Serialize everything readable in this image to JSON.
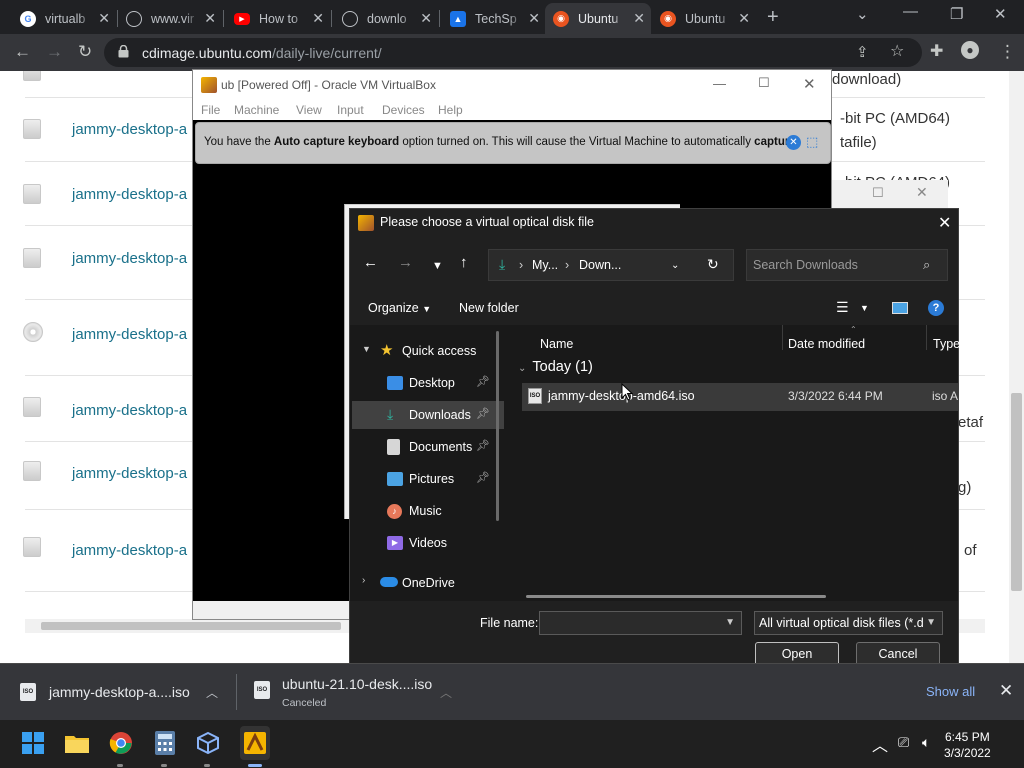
{
  "browser": {
    "tabs": [
      {
        "label": "virtualb",
        "icon": "google-icon",
        "active": false
      },
      {
        "label": "www.vir",
        "icon": "globe-icon",
        "active": false
      },
      {
        "label": "How to",
        "icon": "youtube-icon",
        "active": false
      },
      {
        "label": "downlo",
        "icon": "globe-icon",
        "active": false
      },
      {
        "label": "TechSp",
        "icon": "techspot-icon",
        "active": false
      },
      {
        "label": "Ubuntu",
        "icon": "ubuntu-icon",
        "active": true
      },
      {
        "label": "Ubuntu",
        "icon": "ubuntu-icon",
        "active": false
      }
    ],
    "url_host": "cdimage.ubuntu.com",
    "url_path": "/daily-live/current/"
  },
  "webpage": {
    "links": [
      "jammy-desktop-a",
      "jammy-desktop-a",
      "jammy-desktop-a",
      "jammy-desktop-a",
      "jammy-desktop-a",
      "jammy-desktop-a",
      "jammy-desktop-a"
    ],
    "right_fragments": [
      "download)",
      "-bit PC (AMD64)",
      "tafile)",
      "-bit PC (AMD64)",
      "etaf",
      "g)",
      "of"
    ]
  },
  "virtualbox": {
    "title": "ub [Powered Off] - Oracle VM VirtualBox",
    "menu": [
      "File",
      "Machine",
      "View",
      "Input",
      "Devices",
      "Help"
    ],
    "notice_pre": "You have the ",
    "notice_bold1": "Auto capture keyboard",
    "notice_mid": " option turned on. This will cause the Virtual Machine to automatically ",
    "notice_bold2": "capture"
  },
  "dialog": {
    "title": "Please choose a virtual optical disk file",
    "breadcrumb": [
      "My...",
      "Down..."
    ],
    "search_placeholder": "Search Downloads",
    "organize": "Organize",
    "new_folder": "New folder",
    "nav": {
      "quick_access": "Quick access",
      "items": [
        {
          "label": "Desktop",
          "pinned": true,
          "color": "#3a8ee6"
        },
        {
          "label": "Downloads",
          "pinned": true,
          "color": "#2fb5a0"
        },
        {
          "label": "Documents",
          "pinned": true,
          "color": "#d6d6d6"
        },
        {
          "label": "Pictures",
          "pinned": true,
          "color": "#4ba3e3"
        },
        {
          "label": "Music",
          "pinned": false,
          "color": "#e6785a"
        },
        {
          "label": "Videos",
          "pinned": false,
          "color": "#8f6ae6"
        }
      ],
      "onedrive": "OneDrive"
    },
    "columns": {
      "name": "Name",
      "date": "Date modified",
      "type": "Type"
    },
    "group": "Today (1)",
    "file": {
      "name": "jammy-desktop-amd64.iso",
      "date": "3/3/2022 6:44 PM",
      "type": "iso A"
    },
    "file_name_label": "File name:",
    "file_name_value": "",
    "file_type": "All virtual optical disk files (*.dr",
    "open": "Open",
    "cancel": "Cancel"
  },
  "downloads": {
    "items": [
      {
        "name": "jammy-desktop-a....iso",
        "status": ""
      },
      {
        "name": "ubuntu-21.10-desk....iso",
        "status": "Canceled"
      }
    ],
    "show_all": "Show all"
  },
  "taskbar": {
    "time": "6:45 PM",
    "date": "3/3/2022"
  }
}
